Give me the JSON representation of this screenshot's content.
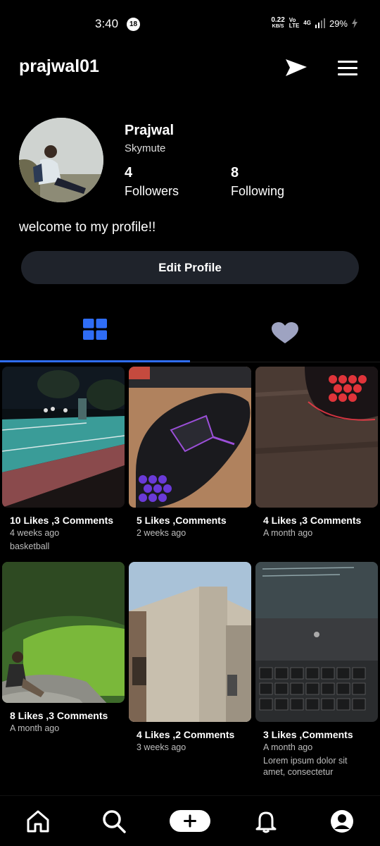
{
  "status_bar": {
    "time": "3:40",
    "notification_count": "18",
    "speed_value": "0.22",
    "speed_unit": "KB/S",
    "volte_top": "Vo",
    "volte_bottom": "LTE",
    "network": "4G",
    "battery": "29%"
  },
  "header": {
    "username": "prajwal01",
    "send_icon": "send-icon",
    "menu_icon": "menu-icon"
  },
  "profile": {
    "name": "Prajwal",
    "subname": "Skymute",
    "followers_count": "4",
    "followers_label": "Followers",
    "following_count": "8",
    "following_label": "Following",
    "bio": "welcome to my profile!!",
    "edit_button": "Edit Profile"
  },
  "tabs": {
    "active": "posts",
    "accent_color": "#2f6df6",
    "inactive_color": "#9ea3c1"
  },
  "posts": [
    {
      "stats": "10 Likes ,3 Comments",
      "time": "4 weeks ago",
      "caption": "basketball"
    },
    {
      "stats": "5 Likes ,Comments",
      "time": "2 weeks ago",
      "caption": ""
    },
    {
      "stats": "4 Likes ,3 Comments",
      "time": "A month ago",
      "caption": ""
    },
    {
      "stats": "8 Likes ,3 Comments",
      "time": "A month ago",
      "caption": ""
    },
    {
      "stats": "4 Likes ,2 Comments",
      "time": "3 weeks ago",
      "caption": ""
    },
    {
      "stats": "3 Likes ,Comments",
      "time": "A month ago",
      "caption": "Lorem ipsum dolor sit amet, consectetur"
    }
  ],
  "bottom_nav": [
    "home-icon",
    "search-icon",
    "add-icon",
    "bell-icon",
    "profile-icon"
  ]
}
